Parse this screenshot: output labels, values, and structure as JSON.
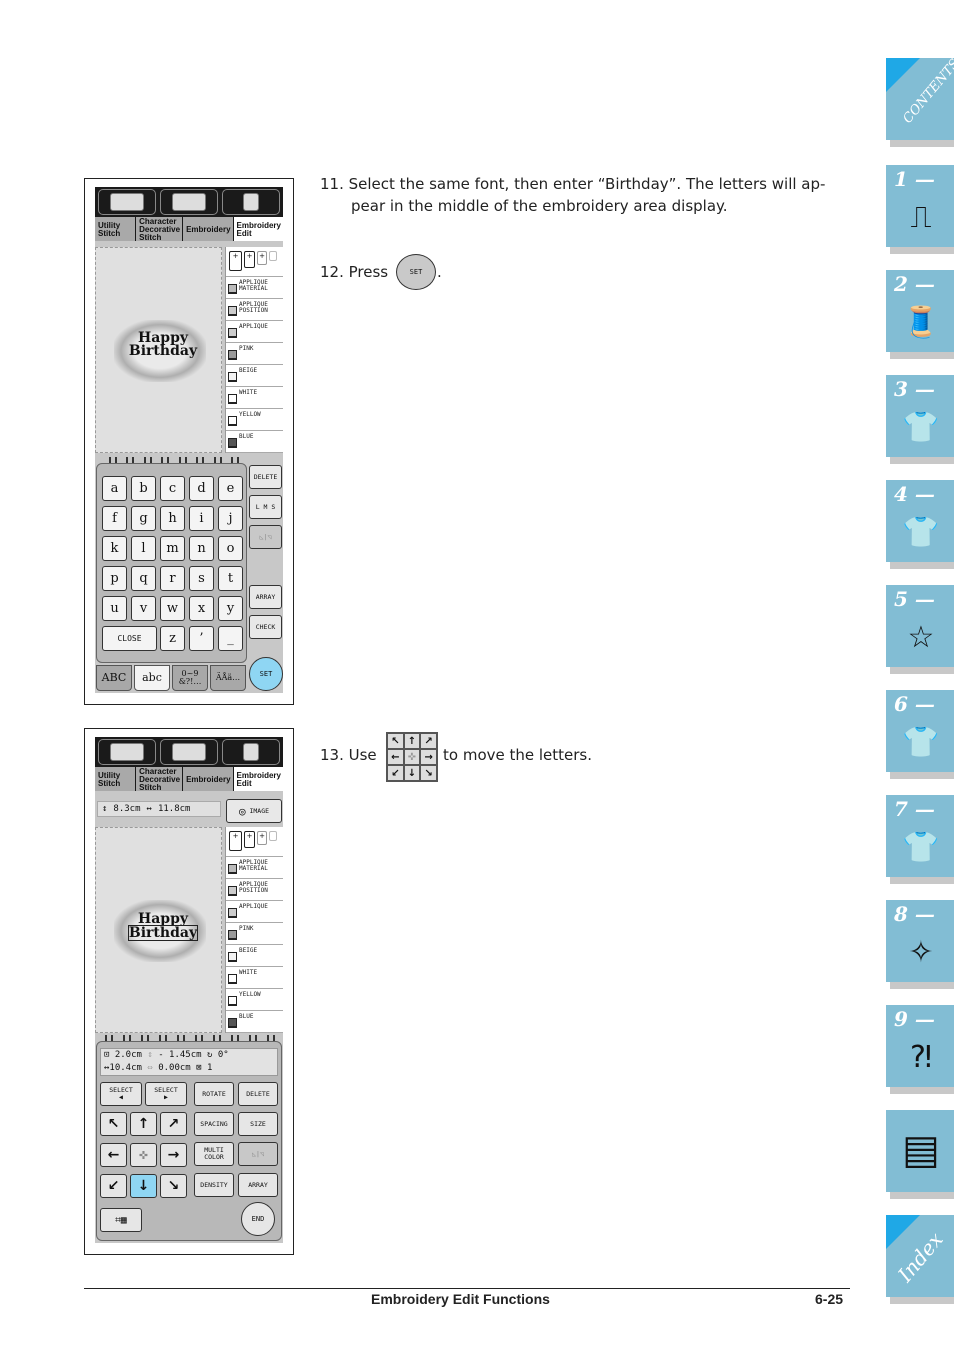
{
  "steps": [
    {
      "num": "11.",
      "text_line1": "Select the same font, then enter “Birthday”. The letters will ap-",
      "text_line2": "pear in the middle of the embroidery area display."
    },
    {
      "num": "12.",
      "text": "Press",
      "button_label": "SET",
      "after": "."
    },
    {
      "num": "13.",
      "text": "Use",
      "after": "to move the letters."
    }
  ],
  "screen1": {
    "tabs": [
      "Utility\nStitch",
      "Character\nDecorative\nStitch",
      "Embroidery",
      "Embroidery\nEdit"
    ],
    "active_tab": 3,
    "preview_text": [
      "Happy",
      "Birthday"
    ],
    "threads": [
      "APPLIQUE\nMATERIAL",
      "APPLIQUE\nPOSITION",
      "APPLIQUE",
      "PINK",
      "BEIGE",
      "WHITE",
      "YELLOW",
      "BLUE"
    ],
    "keys": [
      "a",
      "b",
      "c",
      "d",
      "e",
      "f",
      "g",
      "h",
      "i",
      "j",
      "k",
      "l",
      "m",
      "n",
      "o",
      "p",
      "q",
      "r",
      "s",
      "t",
      "u",
      "v",
      "w",
      "x",
      "y"
    ],
    "bottom_keys": {
      "close": "CLOSE",
      "z": "z",
      "apos": "’",
      "underscore": "_"
    },
    "side_buttons": {
      "delete": "DELETE",
      "size": "L M S",
      "mirror": "◺|◹",
      "array": "ARRAY",
      "check": "CHECK",
      "set": "SET"
    },
    "charset_tabs": [
      "ABC",
      "abc",
      "0~9\n&?!…",
      "ÄÅä…"
    ]
  },
  "screen2": {
    "tabs": [
      "Utility\nStitch",
      "Character\nDecorative\nStitch",
      "Embroidery",
      "Embroidery\nEdit"
    ],
    "size_readout": {
      "height": "8.3cm",
      "width": "11.8cm"
    },
    "image_button": "IMAGE",
    "preview_text": [
      "Happy",
      "Birthday"
    ],
    "threads": [
      "APPLIQUE\nMATERIAL",
      "APPLIQUE\nPOSITION",
      "APPLIQUE",
      "PINK",
      "BEIGE",
      "WHITE",
      "YELLOW",
      "BLUE"
    ],
    "info": {
      "vert": "2.0cm",
      "horiz": "10.4cm",
      "spacing_v": "- 1.45cm",
      "spacing_h": "0.00cm",
      "rotate": "0°",
      "count": "1"
    },
    "buttons": {
      "select_prev": "SELECT\n◀",
      "select_next": "SELECT\n▶",
      "rotate": "ROTATE",
      "delete": "DELETE",
      "spacing": "SPACING",
      "size": "SIZE",
      "multi_color": "MULTI\nCOLOR",
      "mirror": "◺|◹",
      "density": "DENSITY",
      "array": "ARRAY",
      "end": "END"
    },
    "arrows": [
      "↖",
      "↑",
      "↗",
      "←",
      "✜",
      "→",
      "↙",
      "↓",
      "↘"
    ],
    "selected_arrow": 7
  },
  "side_tabs": [
    {
      "label": "CONTENTS",
      "icon": "contents"
    },
    {
      "label": "1 —",
      "icon": "sewing-machine-icon"
    },
    {
      "label": "2 —",
      "icon": "thread-spool-icon"
    },
    {
      "label": "3 —",
      "icon": "shirt-stitch-icon"
    },
    {
      "label": "4 —",
      "icon": "shirt-abc-icon"
    },
    {
      "label": "5 —",
      "icon": "hoop-star-icon"
    },
    {
      "label": "6 —",
      "icon": "shirt-letters-icon"
    },
    {
      "label": "7 —",
      "icon": "shirt-pen-icon"
    },
    {
      "label": "8 —",
      "icon": "machine-cleaning-icon"
    },
    {
      "label": "9 —",
      "icon": "machine-trouble-icon"
    },
    {
      "label": "",
      "icon": "pages-icon"
    },
    {
      "label": "Index",
      "icon": "index"
    }
  ],
  "footer": {
    "title": "Embroidery Edit Functions",
    "page": "6-25"
  },
  "colors": {
    "tab_blue": "#82bdd4",
    "corner_blue": "#1fa8e6",
    "selected_key": "#8fd6f3"
  }
}
